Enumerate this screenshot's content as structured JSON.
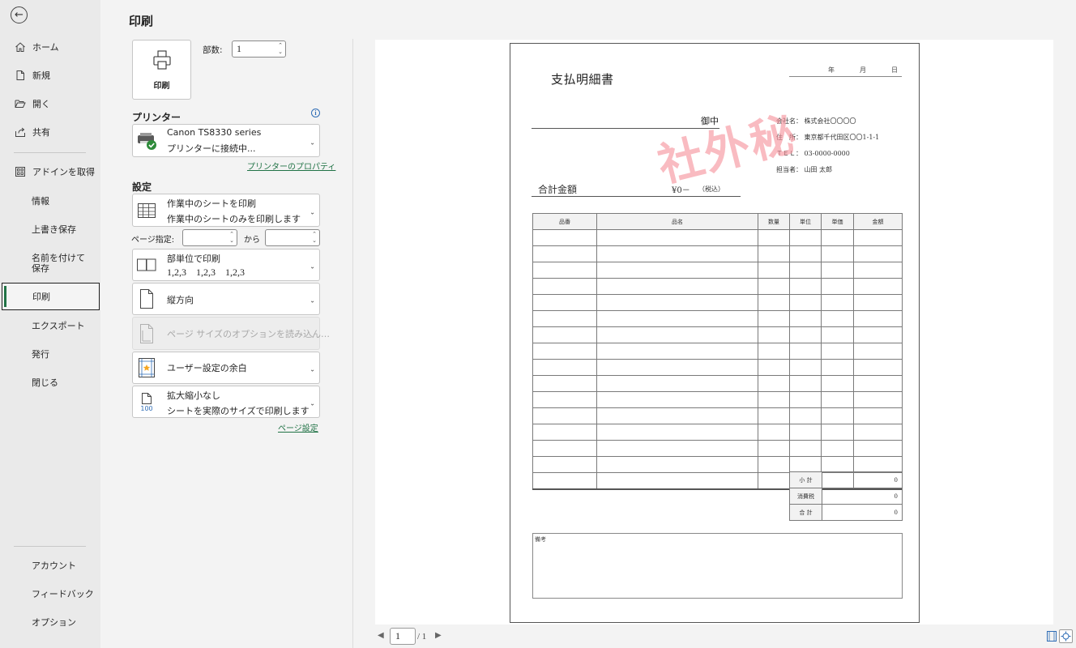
{
  "nav": {
    "back_label": "←",
    "items": [
      {
        "label": "ホーム",
        "icon": "home-icon"
      },
      {
        "label": "新規",
        "icon": "new-file-icon"
      },
      {
        "label": "開く",
        "icon": "folder-open-icon"
      },
      {
        "label": "共有",
        "icon": "share-icon"
      },
      {
        "label": "アドインを取得",
        "icon": "addins-icon"
      },
      {
        "label": "情報"
      },
      {
        "label": "上書き保存"
      },
      {
        "label": "名前を付けて保存"
      },
      {
        "label": "印刷",
        "selected": true
      },
      {
        "label": "エクスポート"
      },
      {
        "label": "発行"
      },
      {
        "label": "閉じる"
      }
    ],
    "bottom_items": [
      {
        "label": "アカウント"
      },
      {
        "label": "フィードバック"
      },
      {
        "label": "オプション"
      }
    ]
  },
  "print_panel": {
    "title": "印刷",
    "print_button_label": "印刷",
    "copies_label": "部数:",
    "copies_value": "1",
    "printer_heading": "プリンター",
    "printer_name": "Canon TS8330 series",
    "printer_status": "プリンターに接続中...",
    "printer_properties_link": "プリンターのプロパティ",
    "settings_heading": "設定",
    "what_to_print": {
      "title": "作業中のシートを印刷",
      "desc": "作業中のシートのみを印刷します"
    },
    "pages_label": "ページ指定:",
    "pages_from": "",
    "pages_to_label": "から",
    "pages_to": "",
    "collation": {
      "title": "部単位で印刷",
      "desc": "1,2,3    1,2,3    1,2,3"
    },
    "orientation": {
      "title": "縦方向"
    },
    "paper_size": {
      "title": "ページ サイズのオプションを読み込ん…"
    },
    "margins": {
      "title": "ユーザー設定の余白"
    },
    "scaling": {
      "title": "拡大縮小なし",
      "desc": "シートを実際のサイズで印刷します",
      "icon_text": "100"
    },
    "page_setup_link": "ページ設定"
  },
  "document": {
    "title": "支払明細書",
    "date_labels": [
      "年",
      "月",
      "日"
    ],
    "onchu": "御中",
    "company_rows": [
      "会社名： 株式会社〇〇〇〇",
      "住　所： 東京都千代田区〇〇1-1-1",
      "ＴＥＬ： 03-0000-0000",
      "担当者： 山田 太郎"
    ],
    "stamp": "社外秘",
    "total_label": "合計金額",
    "total_value": "¥0－",
    "total_note": "（税込）",
    "columns": [
      "品番",
      "品名",
      "数量",
      "単位",
      "単価",
      "金額"
    ],
    "summary": [
      {
        "label": "小 計",
        "value": "0"
      },
      {
        "label": "消費税",
        "value": "0"
      },
      {
        "label": "合 計",
        "value": "0"
      }
    ],
    "remarks_label": "備考"
  },
  "pager": {
    "current": "1",
    "total": "/ 1",
    "prev": "◀",
    "next": "▶"
  },
  "colors": {
    "accent": "#217346",
    "stamp": "#f5919b",
    "nav_bg": "#eaeaea",
    "panel_bg": "#f3f3f3"
  }
}
